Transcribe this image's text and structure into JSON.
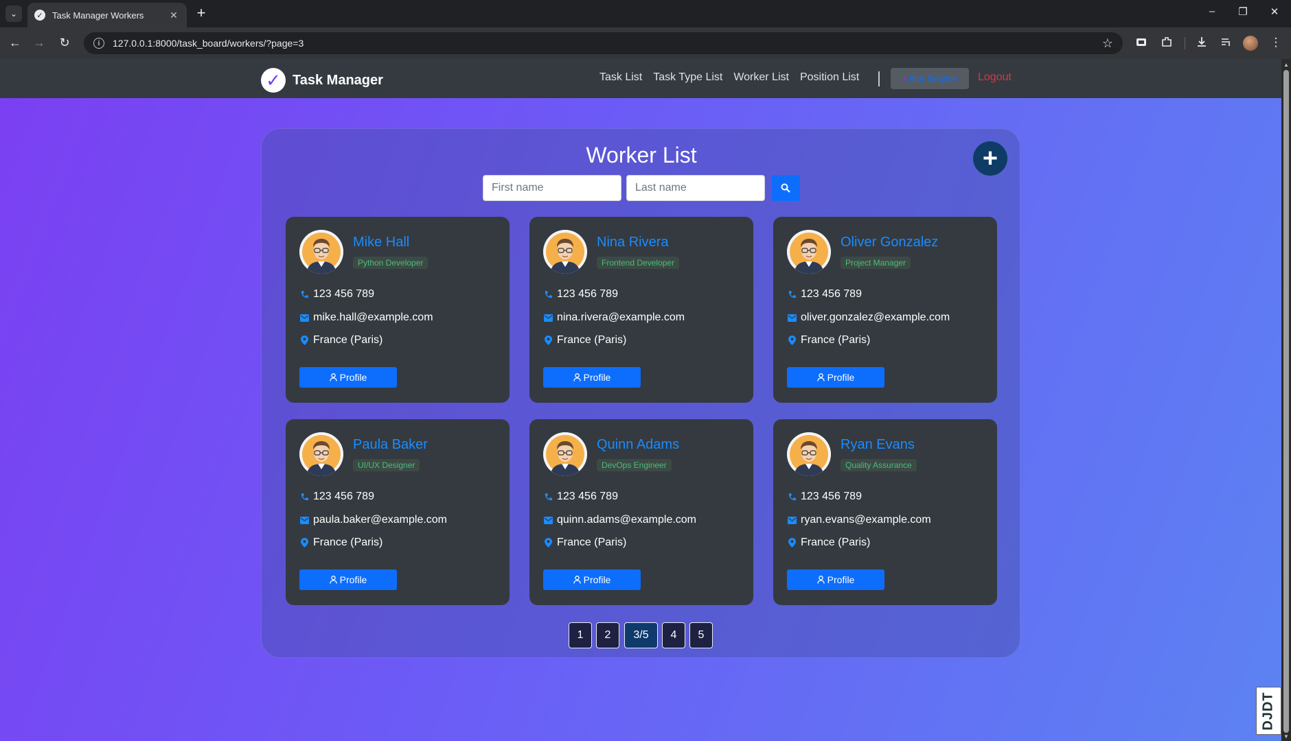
{
  "browser": {
    "tab_title": "Task Manager Workers",
    "url": "127.0.0.1:8000/task_board/workers/?page=3"
  },
  "navbar": {
    "brand": "Task Manager",
    "links": [
      "Task List",
      "Task Type List",
      "Worker List",
      "Position List"
    ],
    "user": "Ihor Dmytriv",
    "logout": "Logout"
  },
  "page": {
    "title": "Worker List",
    "search": {
      "first_placeholder": "First name",
      "last_placeholder": "Last name"
    }
  },
  "workers": [
    {
      "name": "Mike Hall",
      "position": "Python Developer",
      "phone": "123 456 789",
      "email": "mike.hall@example.com",
      "location": "France (Paris)",
      "button": "Profile"
    },
    {
      "name": "Nina Rivera",
      "position": "Frontend Developer",
      "phone": "123 456 789",
      "email": "nina.rivera@example.com",
      "location": "France (Paris)",
      "button": "Profile"
    },
    {
      "name": "Oliver Gonzalez",
      "position": "Project Manager",
      "phone": "123 456 789",
      "email": "oliver.gonzalez@example.com",
      "location": "France (Paris)",
      "button": "Profile"
    },
    {
      "name": "Paula Baker",
      "position": "UI/UX Designer",
      "phone": "123 456 789",
      "email": "paula.baker@example.com",
      "location": "France (Paris)",
      "button": "Profile"
    },
    {
      "name": "Quinn Adams",
      "position": "DevOps Engineer",
      "phone": "123 456 789",
      "email": "quinn.adams@example.com",
      "location": "France (Paris)",
      "button": "Profile"
    },
    {
      "name": "Ryan Evans",
      "position": "Quality Assurance",
      "phone": "123 456 789",
      "email": "ryan.evans@example.com",
      "location": "France (Paris)",
      "button": "Profile"
    }
  ],
  "pagination": [
    "1",
    "2",
    "3/5",
    "4",
    "5"
  ],
  "debug_toolbar": "DJDT",
  "colors": {
    "accent": "#0d6efd",
    "name_link": "#1a8cff",
    "position_badge": "#4cbb7f",
    "logout": "#dc3545",
    "navbar": "#343a40",
    "card": "#343a40"
  }
}
